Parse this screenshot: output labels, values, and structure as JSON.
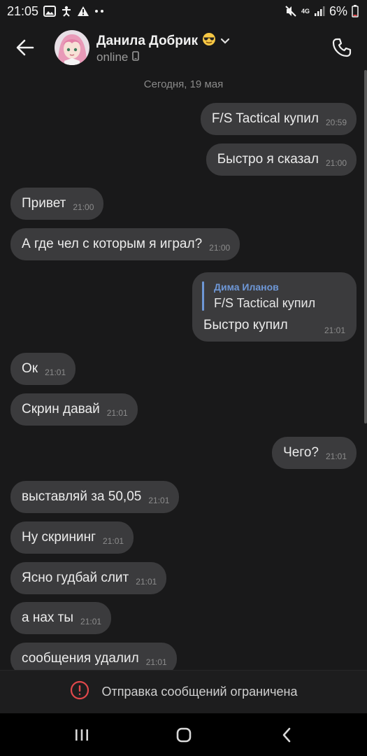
{
  "status_bar": {
    "time": "21:05",
    "network": "4G",
    "battery": "6%"
  },
  "header": {
    "contact_name": "Данила Добрик",
    "status": "online"
  },
  "date_separator": "Сегодня, 19 мая",
  "messages": [
    {
      "text": "F/S Tactical купил",
      "time": "20:59",
      "direction": "out"
    },
    {
      "text": "Быстро я сказал",
      "time": "21:00",
      "direction": "out"
    },
    {
      "text": "Привет",
      "time": "21:00",
      "direction": "in"
    },
    {
      "text": "А где чел с которым я играл?",
      "time": "21:00",
      "direction": "in"
    },
    {
      "text": "Быстро купил",
      "time": "21:01",
      "direction": "out",
      "reply_author": "Дима Иланов",
      "reply_quote": "F/S Tactical купил"
    },
    {
      "text": "Ок",
      "time": "21:01",
      "direction": "in"
    },
    {
      "text": "Скрин давай",
      "time": "21:01",
      "direction": "in"
    },
    {
      "text": "Чего?",
      "time": "21:01",
      "direction": "out"
    },
    {
      "text": "выставляй за 50,05",
      "time": "21:01",
      "direction": "in"
    },
    {
      "text": "Ну скрининг",
      "time": "21:01",
      "direction": "in"
    },
    {
      "text": "Ясно гудбай слит",
      "time": "21:01",
      "direction": "in"
    },
    {
      "text": "а нах ты",
      "time": "21:01",
      "direction": "in"
    },
    {
      "text": "сообщения удалил",
      "time": "21:01",
      "direction": "in"
    }
  ],
  "restriction_text": "Отправка сообщений ограничена",
  "colors": {
    "background": "#19191a",
    "bubble": "#3b3b3d",
    "reply_accent": "#6e97d6",
    "warning": "#e0484b"
  }
}
